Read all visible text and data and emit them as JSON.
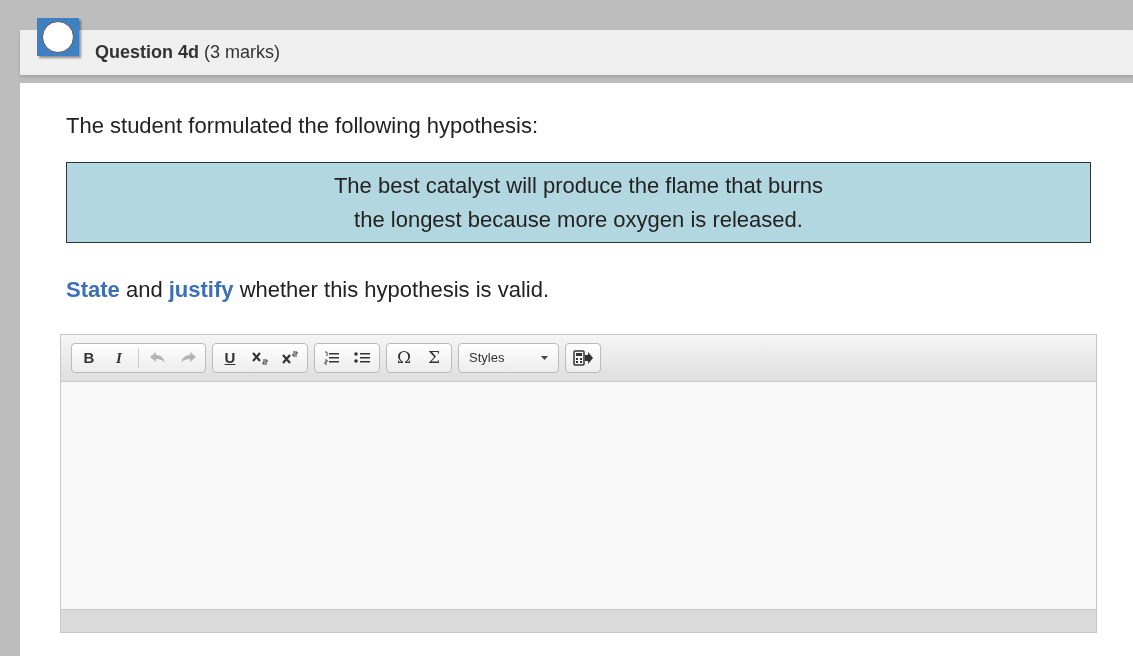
{
  "question": {
    "heading": "**Question 4d** (3 marks)"
  },
  "intro": "The student formulated the following hypothesis:",
  "hypothesis": [
    "The best catalyst will produce the flame that burns",
    "the longest because more oxygen is released."
  ],
  "prompt": "**State** and **justify** whether this hypothesis is valid.",
  "toolbar": [
    [
      {
        "kind": "bold",
        "label": "B",
        "disabled": false
      },
      {
        "kind": "italic",
        "label": "I",
        "disabled": false
      },
      {
        "kind": "separator"
      },
      {
        "kind": "undo",
        "disabled": true
      },
      {
        "kind": "redo",
        "disabled": true
      }
    ],
    [
      {
        "kind": "underline",
        "label": "U",
        "disabled": false
      },
      {
        "kind": "subscript",
        "disabled": false
      },
      {
        "kind": "superscript",
        "disabled": false
      }
    ],
    [
      {
        "kind": "ordered-list",
        "disabled": false
      },
      {
        "kind": "bullet-list",
        "disabled": false
      }
    ],
    [
      {
        "kind": "symbol",
        "label": "Ω",
        "disabled": false
      },
      {
        "kind": "symbol",
        "label": "Σ",
        "disabled": false
      }
    ],
    [
      {
        "kind": "dropdown",
        "label": "Styles"
      }
    ],
    [
      {
        "kind": "calculator",
        "disabled": false
      }
    ]
  ]
}
